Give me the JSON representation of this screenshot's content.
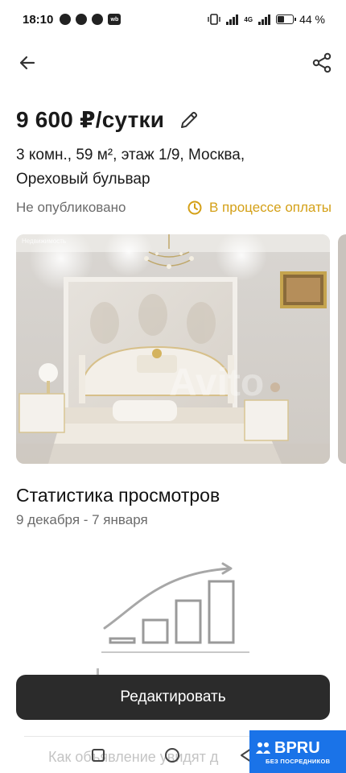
{
  "status_bar": {
    "time": "18:10",
    "battery": "44 %",
    "network": "4G"
  },
  "listing": {
    "price": "9 600 ₽/сутки",
    "address_line1": "3 комн., 59 м², этаж 1/9, Москва,",
    "address_line2": "Ореховый бульвар",
    "status_unpublished": "Не опубликовано",
    "status_payment": "В процессе оплаты",
    "photo_label": "Недвижимость",
    "photo_watermark": "Avito"
  },
  "stats": {
    "title": "Статистика просмотров",
    "range": "9 декабря - 7 января"
  },
  "actions": {
    "edit_label": "Редактировать",
    "hint": "Как объявление увидят д"
  },
  "watermark": {
    "brand": "BPRU",
    "tagline": "БЕЗ ПОСРЕДНИКОВ"
  },
  "colors": {
    "accent_yellow": "#d4a017",
    "button_dark": "#2b2b2b",
    "watermark_blue": "#1a73e8"
  }
}
